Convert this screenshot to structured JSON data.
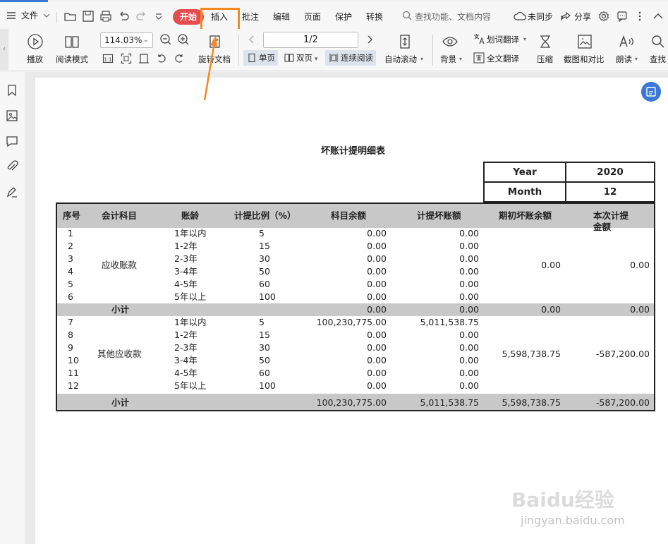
{
  "menubar": {
    "file_label": "文件",
    "start_label": "开始",
    "tabs": [
      "插入",
      "批注",
      "编辑",
      "页面",
      "保护",
      "转换"
    ],
    "search_label": "查找功能、文档内容",
    "sync_label": "未同步",
    "share_label": "分享"
  },
  "toolbar": {
    "play_label": "播放",
    "read_mode_label": "阅读模式",
    "zoom_value": "114.03%",
    "rotate_label": "旋转文档",
    "page_value": "1/2",
    "single_label": "单页",
    "double_label": "双页",
    "continuous_label": "连续阅读",
    "auto_scroll_label": "自动滚动",
    "background_label": "背景",
    "word_translate_label": "划词翻译",
    "full_translate_label": "全文翻译",
    "compress_label": "压缩",
    "screenshot_label": "截图和对比",
    "read_aloud_label": "朗读",
    "find_label": "查找"
  },
  "document": {
    "title": "坏账计提明细表",
    "year_label": "Year",
    "year_value": "2020",
    "month_label": "Month",
    "month_value": "12",
    "headers": [
      "序号",
      "会计科目",
      "账龄",
      "计提比例（%）",
      "科目余额",
      "计提坏账额",
      "期初坏账余额",
      "本次计提",
      "金额"
    ],
    "group1_name": "应收账款",
    "group2_name": "其他应收款",
    "rows": [
      {
        "no": "1",
        "age": "1年以内",
        "ratio": "5",
        "balance": "0.00",
        "provision": "0.00"
      },
      {
        "no": "2",
        "age": "1-2年",
        "ratio": "15",
        "balance": "0.00",
        "provision": "0.00"
      },
      {
        "no": "3",
        "age": "2-3年",
        "ratio": "30",
        "balance": "0.00",
        "provision": "0.00"
      },
      {
        "no": "4",
        "age": "3-4年",
        "ratio": "50",
        "balance": "0.00",
        "provision": "0.00"
      },
      {
        "no": "5",
        "age": "4-5年",
        "ratio": "60",
        "balance": "0.00",
        "provision": "0.00"
      },
      {
        "no": "6",
        "age": "5年以上",
        "ratio": "100",
        "balance": "0.00",
        "provision": "0.00"
      },
      {
        "no": "7",
        "age": "1年以内",
        "ratio": "5",
        "balance": "100,230,775.00",
        "provision": "5,011,538.75"
      },
      {
        "no": "8",
        "age": "1-2年",
        "ratio": "15",
        "balance": "0.00",
        "provision": "0.00"
      },
      {
        "no": "9",
        "age": "2-3年",
        "ratio": "30",
        "balance": "0.00",
        "provision": "0.00"
      },
      {
        "no": "10",
        "age": "3-4年",
        "ratio": "50",
        "balance": "0.00",
        "provision": "0.00"
      },
      {
        "no": "11",
        "age": "4-5年",
        "ratio": "60",
        "balance": "0.00",
        "provision": "0.00"
      },
      {
        "no": "12",
        "age": "5年以上",
        "ratio": "100",
        "balance": "0.00",
        "provision": "0.00"
      }
    ],
    "group1_opening": "0.00",
    "group1_current": "0.00",
    "group2_opening": "5,598,738.75",
    "group2_current": "-587,200.00",
    "subtotal_label": "小计",
    "subtotal1": {
      "balance": "0.00",
      "provision": "0.00",
      "opening": "0.00",
      "current": "0.00"
    },
    "subtotal2": {
      "balance": "100,230,775.00",
      "provision": "5,011,538.75",
      "opening": "5,598,738.75",
      "current": "-587,200.00"
    }
  },
  "watermark": {
    "brand_text": "Baidu经验",
    "url_text": "jingyan.baidu.com"
  },
  "colors": {
    "accent": "#3b78d8",
    "start_tab": "#e44d4d",
    "highlight": "#f08a22"
  }
}
